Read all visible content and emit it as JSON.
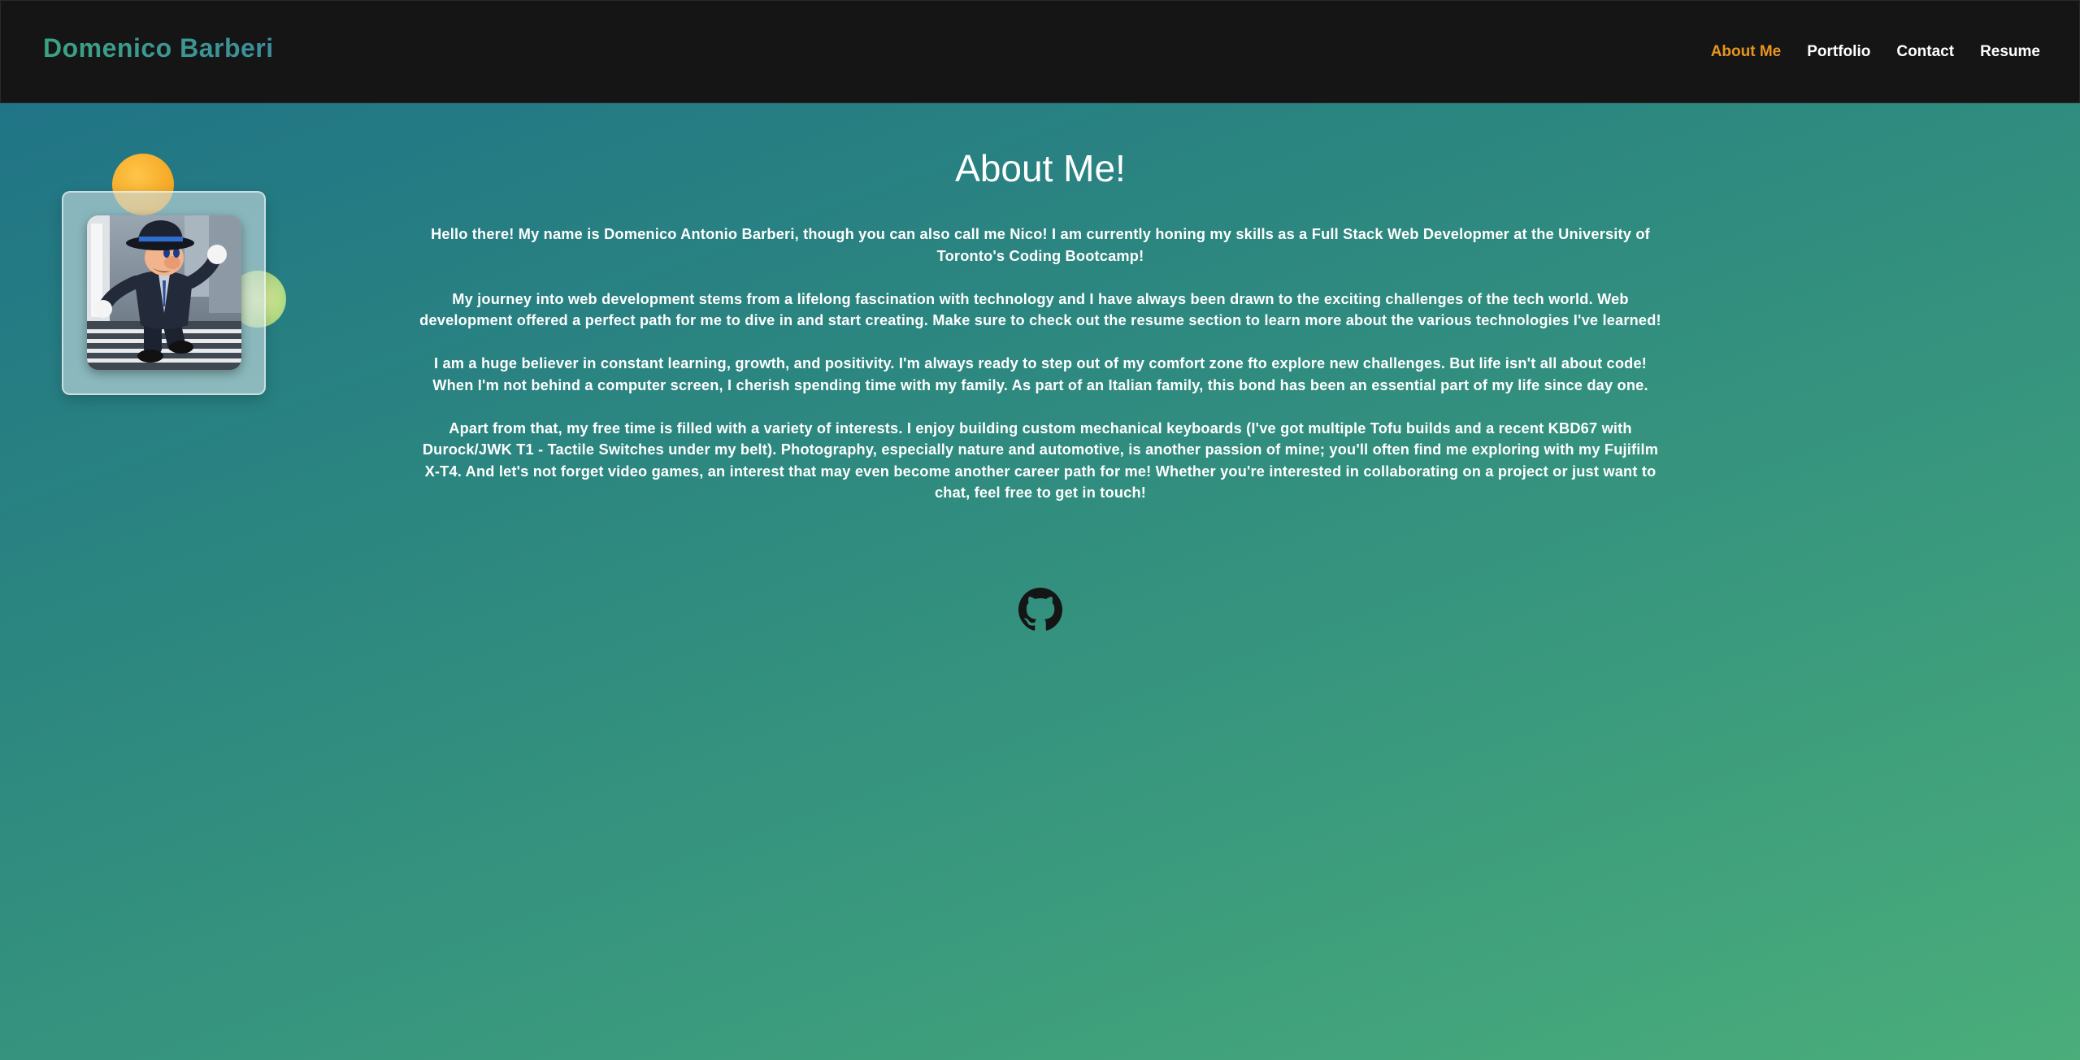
{
  "header": {
    "brand": "Domenico Barberi",
    "nav": [
      {
        "label": "About Me",
        "active": true
      },
      {
        "label": "Portfolio",
        "active": false
      },
      {
        "label": "Contact",
        "active": false
      },
      {
        "label": "Resume",
        "active": false
      }
    ]
  },
  "main": {
    "title": "About Me!",
    "paragraphs": [
      "Hello there! My name is Domenico Antonio Barberi, though you can also call me Nico! I am currently honing my skills as a Full Stack Web Developmer at the University of Toronto's Coding Bootcamp!",
      "My journey into web development stems from a lifelong fascination with technology and I have always been drawn to the exciting challenges of the tech world. Web development offered a perfect path for me to dive in and start creating. Make sure to check out the resume section to learn more about the various technologies I've learned!",
      "I am a huge believer in constant learning, growth, and positivity. I'm always ready to step out of my comfort zone fto explore new challenges. But life isn't all about code! When I'm not behind a computer screen, I cherish spending time with my family. As part of an Italian family, this bond has been an essential part of my life since day one.",
      "Apart from that, my free time is filled with a variety of interests. I enjoy building custom mechanical keyboards (I've got multiple Tofu builds and a recent KBD67 with Durock/JWK T1 - Tactile Switches under my belt). Photography, especially nature and automotive, is another passion of mine; you'll often find me exploring with my Fujifilm X-T4. And let's not forget video games, an interest that may even become another career path for me! Whether you're interested in collaborating on a project or just want to chat, feel free to get in touch!"
    ],
    "social_icon": "github-icon"
  },
  "colors": {
    "header_bg": "#151515",
    "active_nav": "#e8951f",
    "brand_gradient_start": "#3aa383",
    "brand_gradient_end": "#3d8e9c",
    "bg_gradient_start": "#1e7187",
    "bg_gradient_end": "#4aad7a",
    "accent_orange": "#f5a623",
    "accent_green": "#b6dc86"
  }
}
